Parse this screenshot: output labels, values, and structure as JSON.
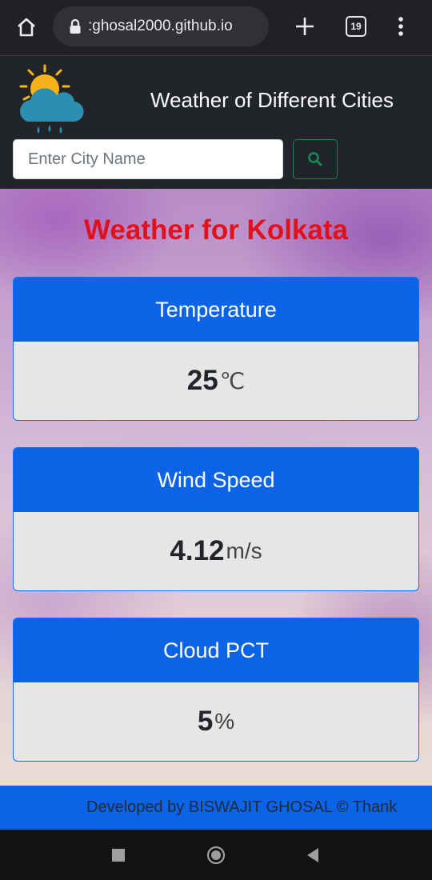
{
  "browser": {
    "url": ":ghosal2000.github.io",
    "tab_count": "19"
  },
  "header": {
    "title": "Weather of Different Cities",
    "search_placeholder": "Enter City Name",
    "logo_icon": "sun-cloud-rain-icon",
    "search_icon": "search-icon"
  },
  "main": {
    "heading": "Weather for Kolkata",
    "cards": [
      {
        "label": "Temperature",
        "value": "25",
        "unit": "℃"
      },
      {
        "label": "Wind Speed",
        "value": "4.12",
        "unit": "m/s"
      },
      {
        "label": "Cloud PCT",
        "value": "5",
        "unit": "%"
      }
    ]
  },
  "footer": {
    "text": "Developed by BISWAJIT GHOSAL © Thank"
  },
  "colors": {
    "header_bg": "#212529",
    "card_header": "#0d63e6",
    "heading_red": "#e0101d",
    "search_border": "#198754"
  }
}
